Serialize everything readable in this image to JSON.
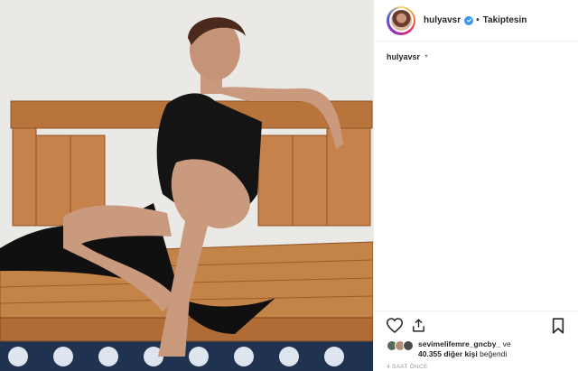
{
  "post": {
    "owner_username": "hulyavsr",
    "follow_status": "Takiptesin",
    "separator": "•",
    "caption_username": "hulyavsr"
  },
  "likes": {
    "first_liker": "sevimelifemre_gncby_",
    "connector": "ve",
    "others_count_text": "40.355 diğer kişi",
    "suffix": "beğendi"
  },
  "timestamp": "4 SAAT ÖNCE",
  "icons": {
    "verified": "verified-badge-icon",
    "like": "heart-icon",
    "share": "share-icon",
    "save": "bookmark-icon",
    "caption_more": "caret-down-icon"
  },
  "colors": {
    "verified": "#3897f0",
    "text": "#262626",
    "muted": "#999999",
    "divider": "#efefef"
  }
}
